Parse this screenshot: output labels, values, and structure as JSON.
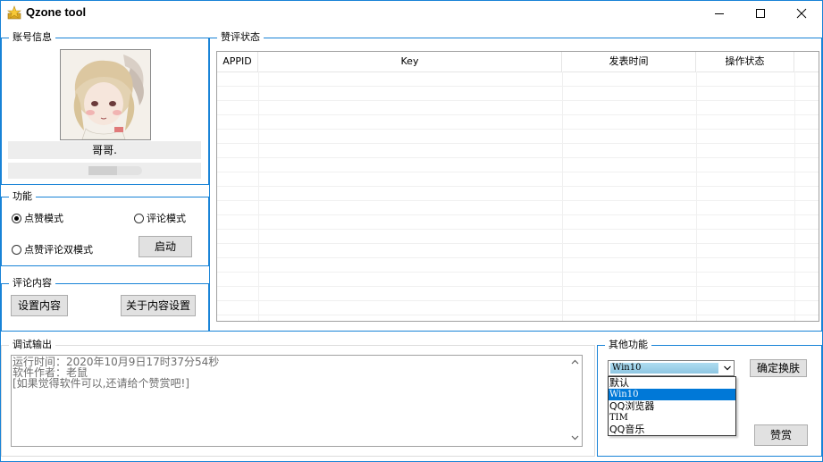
{
  "window": {
    "title": "Qzone tool"
  },
  "account": {
    "legend": "账号信息",
    "nickname": "哥哥."
  },
  "features": {
    "legend": "功能",
    "options": [
      {
        "label": "点赞模式",
        "checked": true
      },
      {
        "label": "评论模式",
        "checked": false
      },
      {
        "label": "点赞评论双模式",
        "checked": false
      }
    ],
    "start_label": "启动"
  },
  "comment": {
    "legend": "评论内容",
    "set_label": "设置内容",
    "about_label": "关于内容设置"
  },
  "status": {
    "legend": "赞评状态",
    "columns": [
      "APPID",
      "Key",
      "发表时间",
      "操作状态"
    ]
  },
  "debug": {
    "legend": "调试输出",
    "lines": [
      "运行时间：2020年10月9日17时37分54秒",
      "软件作者：老鼠",
      "[如果觉得软件可以,还请给个赞赏吧!]"
    ]
  },
  "other": {
    "legend": "其他功能",
    "selected": "Win10",
    "options": [
      "默认",
      "Win10",
      "QQ浏览器",
      "TIM",
      "QQ音乐"
    ],
    "active_index": 1,
    "apply_label": "确定换肤",
    "donate_label": "赞赏"
  },
  "colors": {
    "accent": "#1883d7",
    "selection": "#0078d7"
  }
}
